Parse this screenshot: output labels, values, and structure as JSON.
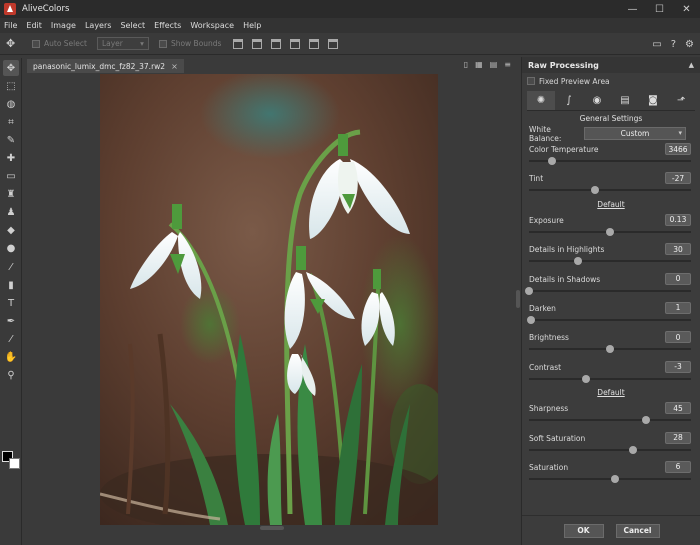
{
  "app": {
    "title": "AliveColors"
  },
  "window_controls": [
    "—",
    "☐",
    "✕"
  ],
  "menu": [
    "File",
    "Edit",
    "Image",
    "Layers",
    "Select",
    "Effects",
    "Workspace",
    "Help"
  ],
  "options_bar": {
    "auto_select_label": "Auto Select",
    "layer_select_value": "Layer",
    "show_bounds_label": "Show Bounds"
  },
  "document": {
    "tab_title": "panasonic_lumix_dmc_fz82_37.rw2",
    "tab_close": "×"
  },
  "panel": {
    "title": "Raw Processing",
    "fixed_preview_label": "Fixed Preview Area",
    "section_general": "General Settings",
    "white_balance_label": "White Balance:",
    "white_balance_value": "Custom",
    "params_a": [
      {
        "label": "Color Temperature",
        "value": "3466",
        "level": 0.14
      },
      {
        "label": "Tint",
        "value": "-27",
        "level": 0.41
      }
    ],
    "default_1": "Default",
    "params_b": [
      {
        "label": "Exposure",
        "value": "0.13",
        "level": 0.5
      },
      {
        "label": "Details in Highlights",
        "value": "30",
        "level": 0.3
      },
      {
        "label": "Details in Shadows",
        "value": "0",
        "level": 0.0
      },
      {
        "label": "Darken",
        "value": "1",
        "level": 0.01
      },
      {
        "label": "Brightness",
        "value": "0",
        "level": 0.5
      },
      {
        "label": "Contrast",
        "value": "-3",
        "level": 0.35
      }
    ],
    "default_2": "Default",
    "params_c": [
      {
        "label": "Sharpness",
        "value": "45",
        "level": 0.72
      },
      {
        "label": "Soft Saturation",
        "value": "28",
        "level": 0.64
      },
      {
        "label": "Saturation",
        "value": "6",
        "level": 0.53
      }
    ],
    "ok_label": "OK",
    "cancel_label": "Cancel"
  },
  "colors": {
    "accent": "#c0392b",
    "panel_bg": "#3c3c3c",
    "app_bg": "#3a3a3a"
  }
}
